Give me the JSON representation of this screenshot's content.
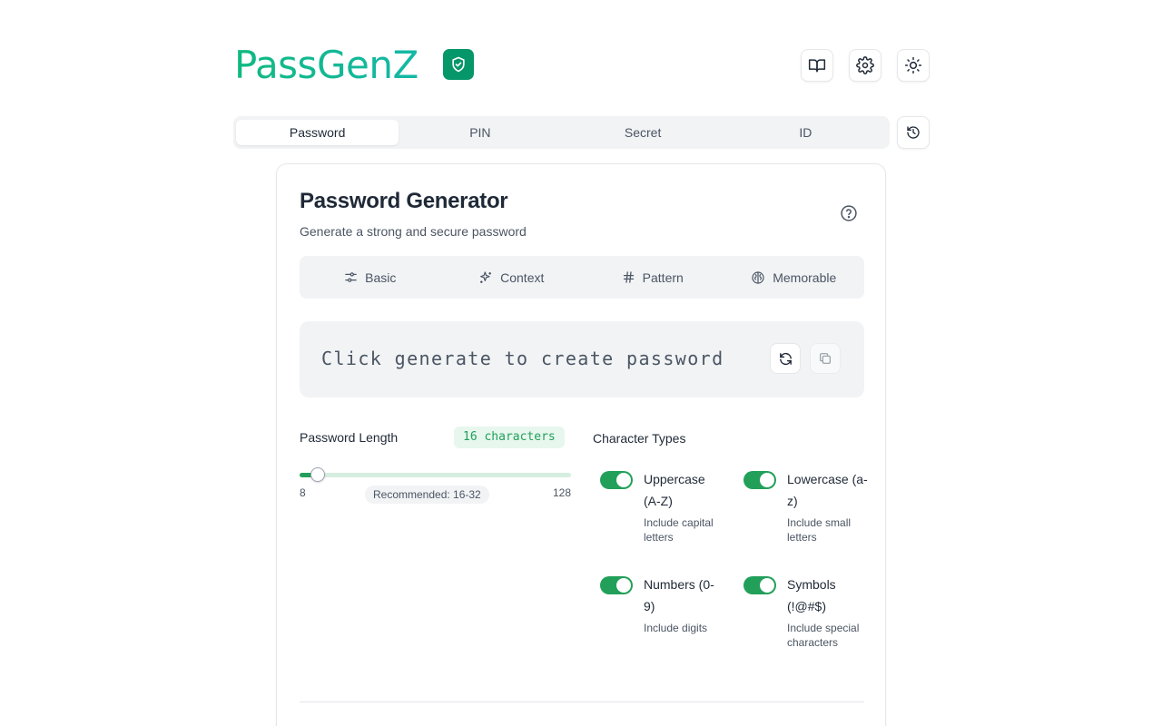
{
  "app": {
    "name": "PassGenZ",
    "brand_color": "#10b981",
    "badge_color": "#059669"
  },
  "header_buttons": [
    {
      "icon": "book-icon"
    },
    {
      "icon": "gear-icon"
    },
    {
      "icon": "sun-icon"
    }
  ],
  "tabs": [
    {
      "label": "Password",
      "active": true
    },
    {
      "label": "PIN",
      "active": false
    },
    {
      "label": "Secret",
      "active": false
    },
    {
      "label": "ID",
      "active": false
    }
  ],
  "history_button": {
    "icon": "history-icon"
  },
  "card": {
    "title": "Password Generator",
    "subtitle": "Generate a strong and secure password",
    "help_icon": "help-circle-icon"
  },
  "modes": [
    {
      "label": "Basic",
      "icon": "sliders-icon"
    },
    {
      "label": "Context",
      "icon": "sparkles-icon"
    },
    {
      "label": "Pattern",
      "icon": "hash-icon"
    },
    {
      "label": "Memorable",
      "icon": "brain-icon"
    }
  ],
  "output": {
    "placeholder": "Click generate to create password",
    "refresh_icon": "refresh-icon",
    "copy_icon": "copy-icon"
  },
  "length": {
    "label": "Password Length",
    "badge": "16 characters",
    "value": 16,
    "min": 8,
    "max": 128,
    "min_label": "8",
    "max_label": "128",
    "recommended": "Recommended: 16-32",
    "accent_color": "#22a05a"
  },
  "character_types": {
    "label": "Character Types",
    "options": [
      {
        "title": "Uppercase (A-Z)",
        "desc": "Include capital letters",
        "enabled": true
      },
      {
        "title": "Lowercase (a-z)",
        "desc": "Include small letters",
        "enabled": true
      },
      {
        "title": "Numbers (0-9)",
        "desc": "Include digits",
        "enabled": true
      },
      {
        "title": "Symbols (!@#$)",
        "desc": "Include special characters",
        "enabled": true
      }
    ]
  }
}
